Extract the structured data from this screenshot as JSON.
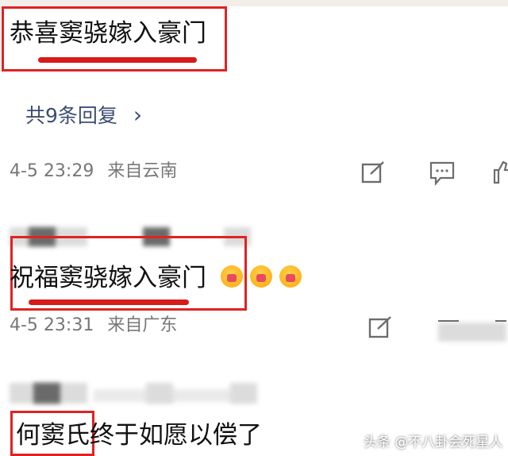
{
  "comments": [
    {
      "text": "恭喜窦骁嫁入豪门",
      "reply_count": "共9条回复",
      "time": "4-5 23:29",
      "location": "来自云南"
    },
    {
      "text": "祝福窦骁嫁入豪门",
      "time": "4-5 23:31",
      "location": "来自广东"
    },
    {
      "text_highlight": "何窦氏",
      "text_rest": "终于如愿以偿了"
    }
  ],
  "reply_chevron": "›",
  "watermark": "头条 @不八卦会死星人",
  "colors": {
    "highlight": "#e02222",
    "reply_link": "#3d4d72",
    "meta": "#777777"
  },
  "icons": [
    "edit-icon",
    "comment-icon",
    "like-icon",
    "emoji-icon"
  ]
}
